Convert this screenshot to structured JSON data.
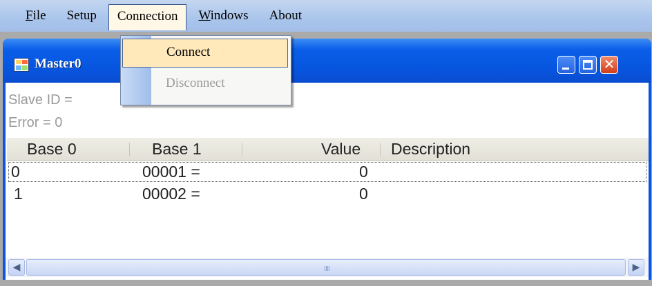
{
  "menubar": {
    "file": {
      "mnemonic": "F",
      "rest": "ile"
    },
    "setup": "Setup",
    "connection": "Connection",
    "windows": {
      "mnemonic": "W",
      "rest": "indows"
    },
    "about": "About"
  },
  "window": {
    "title": "Master0",
    "slave_id": "Slave ID = ",
    "error": "Error = 0"
  },
  "list": {
    "columns": [
      "Base 0",
      "Base 1",
      "Value",
      "Description"
    ],
    "rows": [
      {
        "base0": "0",
        "base1": "00001  =",
        "value": "0",
        "description": ""
      },
      {
        "base0": "1",
        "base1": "00002  =",
        "value": "0",
        "description": ""
      }
    ]
  },
  "scrollbar": {
    "grip": "IIII"
  },
  "dropdown": {
    "items": [
      "Connect",
      "Disconnect"
    ]
  },
  "colors": {
    "titlebar": "#0755df",
    "menu_highlight": "#ffe8b9",
    "menubar": "#aac5ec"
  }
}
